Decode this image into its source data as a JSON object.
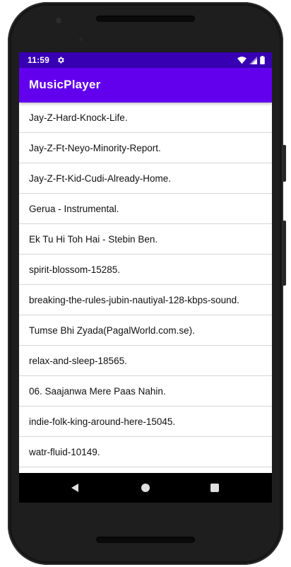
{
  "status_bar": {
    "time": "11:59"
  },
  "app_bar": {
    "title": "MusicPlayer"
  },
  "songs": [
    "Jay-Z-Hard-Knock-Life.",
    "Jay-Z-Ft-Neyo-Minority-Report.",
    "Jay-Z-Ft-Kid-Cudi-Already-Home.",
    "Gerua - Instrumental.",
    "Ek Tu Hi Toh Hai - Stebin Ben.",
    "spirit-blossom-15285.",
    "breaking-the-rules-jubin-nautiyal-128-kbps-sound.",
    "Tumse Bhi Zyada(PagalWorld.com.se).",
    "relax-and-sleep-18565.",
    "06. Saajanwa Mere Paas Nahin.",
    "indie-folk-king-around-here-15045.",
    "watr-fluid-10149.",
    ""
  ],
  "colors": {
    "status_bar": "#3700b3",
    "app_bar": "#6200ee",
    "nav_bar": "#000000"
  },
  "icons": {
    "status_left": "gear-icon",
    "status_right": [
      "wifi-icon",
      "signal-icon",
      "battery-icon"
    ],
    "nav": [
      "back-icon",
      "home-icon",
      "recents-icon"
    ]
  }
}
